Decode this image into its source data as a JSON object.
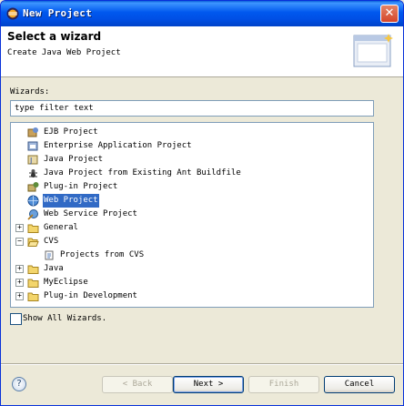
{
  "window": {
    "title": "New Project",
    "close_label": "✕"
  },
  "header": {
    "title": "Select a wizard",
    "subtitle": "Create Java Web Project"
  },
  "filter": {
    "label": "Wizards:",
    "value": "type filter text"
  },
  "tree": {
    "items": [
      {
        "label": "EJB Project",
        "icon": "ejb-project-icon",
        "level": 1,
        "expandable": false
      },
      {
        "label": "Enterprise Application Project",
        "icon": "enterprise-app-project-icon",
        "level": 1,
        "expandable": false
      },
      {
        "label": "Java Project",
        "icon": "java-project-icon",
        "level": 1,
        "expandable": false
      },
      {
        "label": "Java Project from Existing Ant Buildfile",
        "icon": "ant-project-icon",
        "level": 1,
        "expandable": false
      },
      {
        "label": "Plug-in Project",
        "icon": "plugin-project-icon",
        "level": 1,
        "expandable": false
      },
      {
        "label": "Web Project",
        "icon": "web-project-icon",
        "level": 1,
        "expandable": false,
        "selected": true
      },
      {
        "label": "Web Service Project",
        "icon": "web-service-project-icon",
        "level": 1,
        "expandable": false
      },
      {
        "label": "General",
        "icon": "folder-icon",
        "level": 1,
        "expandable": true,
        "expanded": false
      },
      {
        "label": "CVS",
        "icon": "folder-open-icon",
        "level": 1,
        "expandable": true,
        "expanded": true
      },
      {
        "label": "Projects from CVS",
        "icon": "cvs-checkout-icon",
        "level": 2,
        "expandable": false
      },
      {
        "label": "Java",
        "icon": "folder-icon",
        "level": 1,
        "expandable": true,
        "expanded": false
      },
      {
        "label": "MyEclipse",
        "icon": "folder-icon",
        "level": 1,
        "expandable": true,
        "expanded": false
      },
      {
        "label": "Plug-in Development",
        "icon": "folder-icon",
        "level": 1,
        "expandable": true,
        "expanded": false
      }
    ]
  },
  "options": {
    "show_all_label": "Show All Wizards.",
    "show_all_checked": false
  },
  "buttons": {
    "back": "< Back",
    "next": "Next >",
    "finish": "Finish",
    "cancel": "Cancel",
    "help": "?"
  },
  "colors": {
    "selection": "#316ac5",
    "titlebar": "#0058ee",
    "dialog_bg": "#ece9d8"
  }
}
